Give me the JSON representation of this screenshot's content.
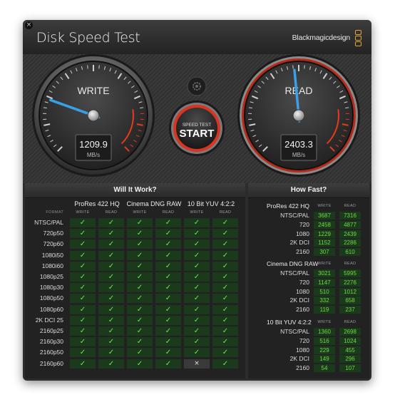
{
  "window": {
    "app_title": "Disk Speed Test",
    "brand": "Blackmagicdesign",
    "close_symbol": "×"
  },
  "gauges": {
    "write": {
      "label": "WRITE",
      "value": "1209.9",
      "unit": "MB/s",
      "needle_fraction": 0.24,
      "accent": "#e83a1a"
    },
    "read": {
      "label": "READ",
      "value": "2403.3",
      "unit": "MB/s",
      "needle_fraction": 0.48,
      "accent": "#e83a1a"
    }
  },
  "start_button": {
    "line1": "SPEED TEST",
    "line2": "START",
    "ring_color": "#d9341f"
  },
  "settings_icon": "gear-icon",
  "will_it_work": {
    "title": "Will It Work?",
    "format_header": "FORMAT",
    "groups": [
      "ProRes 422 HQ",
      "Cinema DNG RAW",
      "10 Bit YUV 4:2:2"
    ],
    "sub_write": "WRITE",
    "sub_read": "READ",
    "rows": [
      {
        "format": "NTSC/PAL",
        "checks": [
          1,
          1,
          1,
          1,
          1,
          1
        ]
      },
      {
        "format": "720p50",
        "checks": [
          1,
          1,
          1,
          1,
          1,
          1
        ]
      },
      {
        "format": "720p60",
        "checks": [
          1,
          1,
          1,
          1,
          1,
          1
        ]
      },
      {
        "format": "1080i50",
        "checks": [
          1,
          1,
          1,
          1,
          1,
          1
        ]
      },
      {
        "format": "1080i60",
        "checks": [
          1,
          1,
          1,
          1,
          1,
          1
        ]
      },
      {
        "format": "1080p25",
        "checks": [
          1,
          1,
          1,
          1,
          1,
          1
        ]
      },
      {
        "format": "1080p30",
        "checks": [
          1,
          1,
          1,
          1,
          1,
          1
        ]
      },
      {
        "format": "1080p50",
        "checks": [
          1,
          1,
          1,
          1,
          1,
          1
        ]
      },
      {
        "format": "1080p60",
        "checks": [
          1,
          1,
          1,
          1,
          1,
          1
        ]
      },
      {
        "format": "2K DCI 25",
        "checks": [
          1,
          1,
          1,
          1,
          1,
          1
        ]
      },
      {
        "format": "2160p25",
        "checks": [
          1,
          1,
          1,
          1,
          1,
          1
        ]
      },
      {
        "format": "2160p30",
        "checks": [
          1,
          1,
          1,
          1,
          1,
          1
        ]
      },
      {
        "format": "2160p50",
        "checks": [
          1,
          1,
          1,
          1,
          1,
          1
        ]
      },
      {
        "format": "2160p60",
        "checks": [
          1,
          1,
          1,
          1,
          0,
          1
        ]
      }
    ],
    "check_symbol": "✓",
    "cross_symbol": "×"
  },
  "how_fast": {
    "title": "How Fast?",
    "sub_write": "WRITE",
    "sub_read": "READ",
    "groups": [
      {
        "name": "ProRes 422 HQ",
        "rows": [
          {
            "label": "NTSC/PAL",
            "write": "3687",
            "read": "7316"
          },
          {
            "label": "720",
            "write": "2458",
            "read": "4877"
          },
          {
            "label": "1080",
            "write": "1229",
            "read": "2439"
          },
          {
            "label": "2K DCI",
            "write": "1152",
            "read": "2286"
          },
          {
            "label": "2160",
            "write": "307",
            "read": "610"
          }
        ]
      },
      {
        "name": "Cinema DNG RAW",
        "rows": [
          {
            "label": "NTSC/PAL",
            "write": "3021",
            "read": "5995"
          },
          {
            "label": "720",
            "write": "1147",
            "read": "2276"
          },
          {
            "label": "1080",
            "write": "510",
            "read": "1012"
          },
          {
            "label": "2K DCI",
            "write": "332",
            "read": "658"
          },
          {
            "label": "2160",
            "write": "119",
            "read": "237"
          }
        ]
      },
      {
        "name": "10 Bit YUV 4:2:2",
        "rows": [
          {
            "label": "NTSC/PAL",
            "write": "1360",
            "read": "2698"
          },
          {
            "label": "720",
            "write": "516",
            "read": "1024"
          },
          {
            "label": "1080",
            "write": "229",
            "read": "455"
          },
          {
            "label": "2K DCI",
            "write": "149",
            "read": "296"
          },
          {
            "label": "2160",
            "write": "54",
            "read": "107"
          }
        ]
      }
    ]
  }
}
